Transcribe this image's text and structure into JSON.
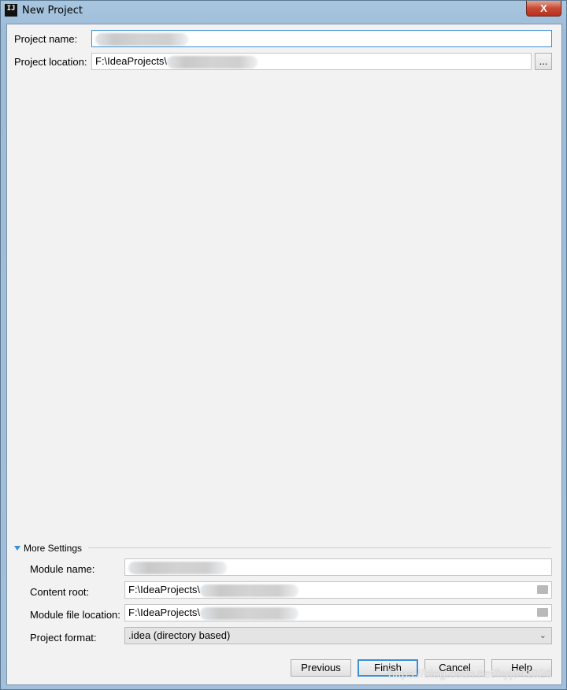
{
  "window": {
    "title": "New Project",
    "app_icon": "IJ",
    "close_label": "X"
  },
  "form": {
    "project_name_label": "Project name:",
    "project_location_label": "Project location:",
    "project_location_value": "F:\\IdeaProjects\\",
    "browse_label": "..."
  },
  "more_settings": {
    "label": "More Settings",
    "module_name_label": "Module name:",
    "content_root_label": "Content root:",
    "content_root_value": "F:\\IdeaProjects\\",
    "module_file_location_label": "Module file location:",
    "module_file_location_value": "F:\\IdeaProjects\\",
    "project_format_label": "Project format:",
    "project_format_value": ".idea (directory based)"
  },
  "buttons": {
    "previous": "Previous",
    "finish": "Finish",
    "cancel": "Cancel",
    "help": "Help"
  },
  "watermark": "https://blog.csdn.net/hyj941026"
}
